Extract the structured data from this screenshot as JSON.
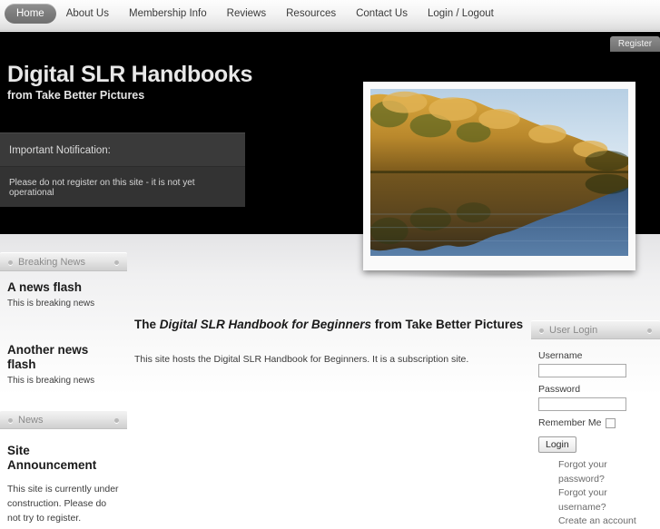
{
  "nav": {
    "items": [
      {
        "label": "Home",
        "active": true
      },
      {
        "label": "About Us",
        "active": false
      },
      {
        "label": "Membership Info",
        "active": false
      },
      {
        "label": "Reviews",
        "active": false
      },
      {
        "label": "Resources",
        "active": false
      },
      {
        "label": "Contact Us",
        "active": false
      },
      {
        "label": "Login / Logout",
        "active": false
      }
    ]
  },
  "header": {
    "register_label": "Register",
    "site_title": "Digital SLR Handbooks",
    "site_subtitle": "from Take Better Pictures",
    "notification": {
      "title": "Important Notification:",
      "text": "Please do not register on this site - it is not yet operational"
    },
    "photo": {
      "name": "autumn-trees-reflected-in-lake-photo",
      "description": "Golden autumn trees along a lake reflected in still blue water"
    }
  },
  "sidebar_left": {
    "breaking_news": {
      "module_title": "Breaking News",
      "items": [
        {
          "title": "A news flash",
          "text": "This is breaking news"
        },
        {
          "title": "Another news flash",
          "text": "This is breaking news"
        }
      ]
    },
    "news": {
      "module_title": "News",
      "announcement": {
        "title": "Site Announcement",
        "text": "This site is currently under construction. Please do not try to register."
      }
    }
  },
  "main": {
    "title_before": "The ",
    "title_italic": "Digital SLR Handbook for Beginners",
    "title_after": " from Take Better Pictures",
    "body": "This site hosts the Digital SLR Handbook for Beginners. It is a subscription site."
  },
  "sidebar_right": {
    "module_title": "User Login",
    "username_label": "Username",
    "username_value": "",
    "username_placeholder": "",
    "password_label": "Password",
    "password_value": "",
    "password_placeholder": "",
    "remember_label": "Remember Me",
    "remember_checked": false,
    "login_button": "Login",
    "links": [
      "Forgot your password?",
      "Forgot your username?",
      "Create an account"
    ]
  },
  "colors": {
    "header_bg": "#000000",
    "nav_active_bg": "#7d7d7d",
    "notify_head_bg": "#3a3a3a",
    "notify_body_bg": "#333333",
    "module_head_bg": "#e3e3e3",
    "link_color": "#6a6a6a"
  }
}
